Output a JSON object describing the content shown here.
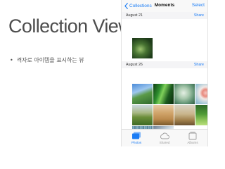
{
  "slide": {
    "title": "Collection View",
    "bullet": "격자로 아이템을 표시하는 뷰"
  },
  "phone": {
    "navbar": {
      "back_label": "Collections",
      "title": "Moments",
      "select_label": "Select"
    },
    "sections": [
      {
        "date": "August 21",
        "share_label": "Share"
      },
      {
        "date": "August 26",
        "share_label": "Share"
      }
    ],
    "tabs": [
      {
        "label": "Photos",
        "icon": "photos-icon",
        "active": true
      },
      {
        "label": "Shared",
        "icon": "shared-cloud-icon",
        "active": false
      },
      {
        "label": "Albums",
        "icon": "albums-icon",
        "active": false
      }
    ],
    "colors": {
      "accent": "#1a7cf5",
      "tab_inactive": "#9a9a9a"
    }
  }
}
